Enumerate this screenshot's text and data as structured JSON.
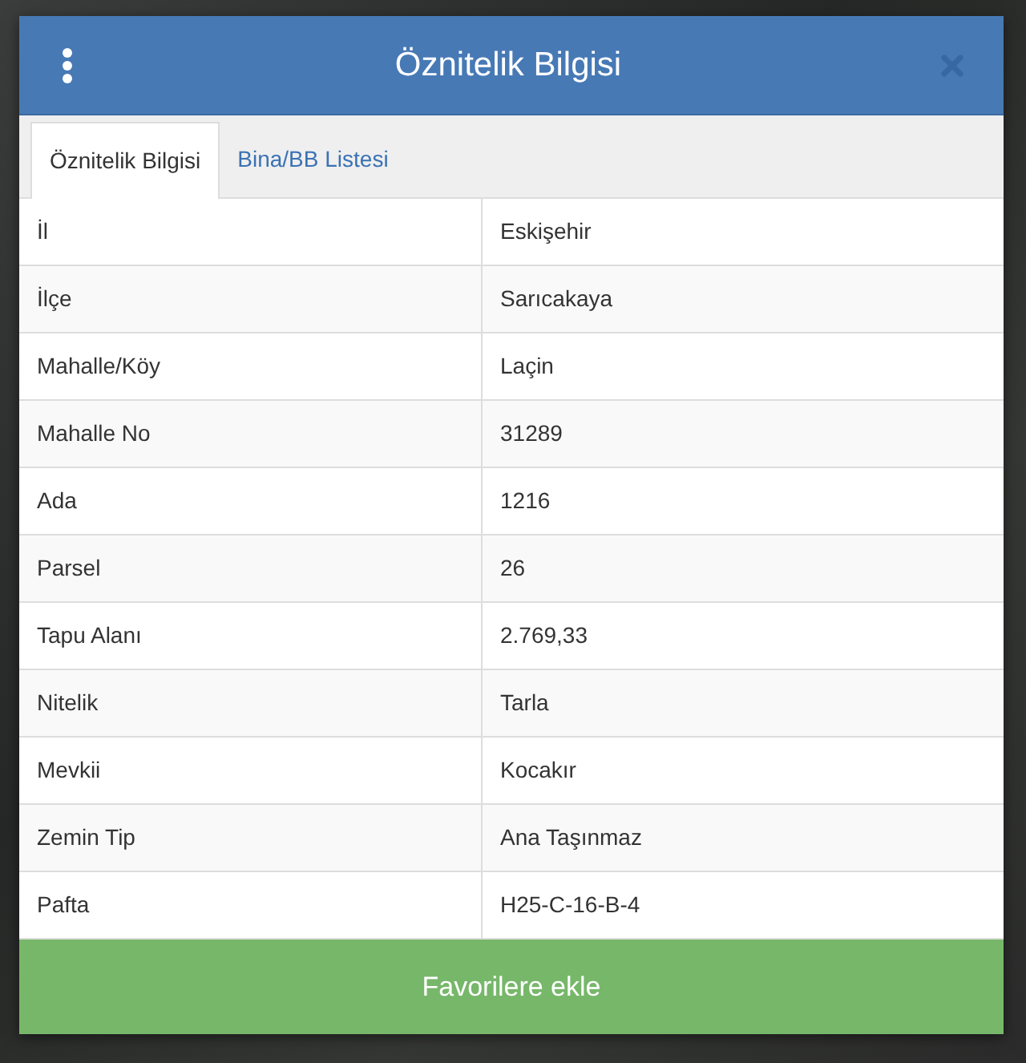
{
  "dialog": {
    "title": "Öznitelik Bilgisi"
  },
  "tabs": [
    {
      "label": "Öznitelik Bilgisi",
      "selected": true
    },
    {
      "label": "Bina/BB Listesi",
      "selected": false
    }
  ],
  "table": {
    "rows": [
      {
        "label": "İl",
        "value": "Eskişehir"
      },
      {
        "label": "İlçe",
        "value": "Sarıcakaya"
      },
      {
        "label": "Mahalle/Köy",
        "value": "Laçin"
      },
      {
        "label": "Mahalle No",
        "value": "31289"
      },
      {
        "label": "Ada",
        "value": "1216"
      },
      {
        "label": "Parsel",
        "value": "26"
      },
      {
        "label": "Tapu Alanı",
        "value": "2.769,33"
      },
      {
        "label": "Nitelik",
        "value": "Tarla"
      },
      {
        "label": "Mevkii",
        "value": "Kocakır"
      },
      {
        "label": "Zemin Tip",
        "value": "Ana Taşınmaz"
      },
      {
        "label": "Pafta",
        "value": "H25-C-16-B-4"
      }
    ]
  },
  "button": {
    "label": "Favorilere ekle"
  }
}
